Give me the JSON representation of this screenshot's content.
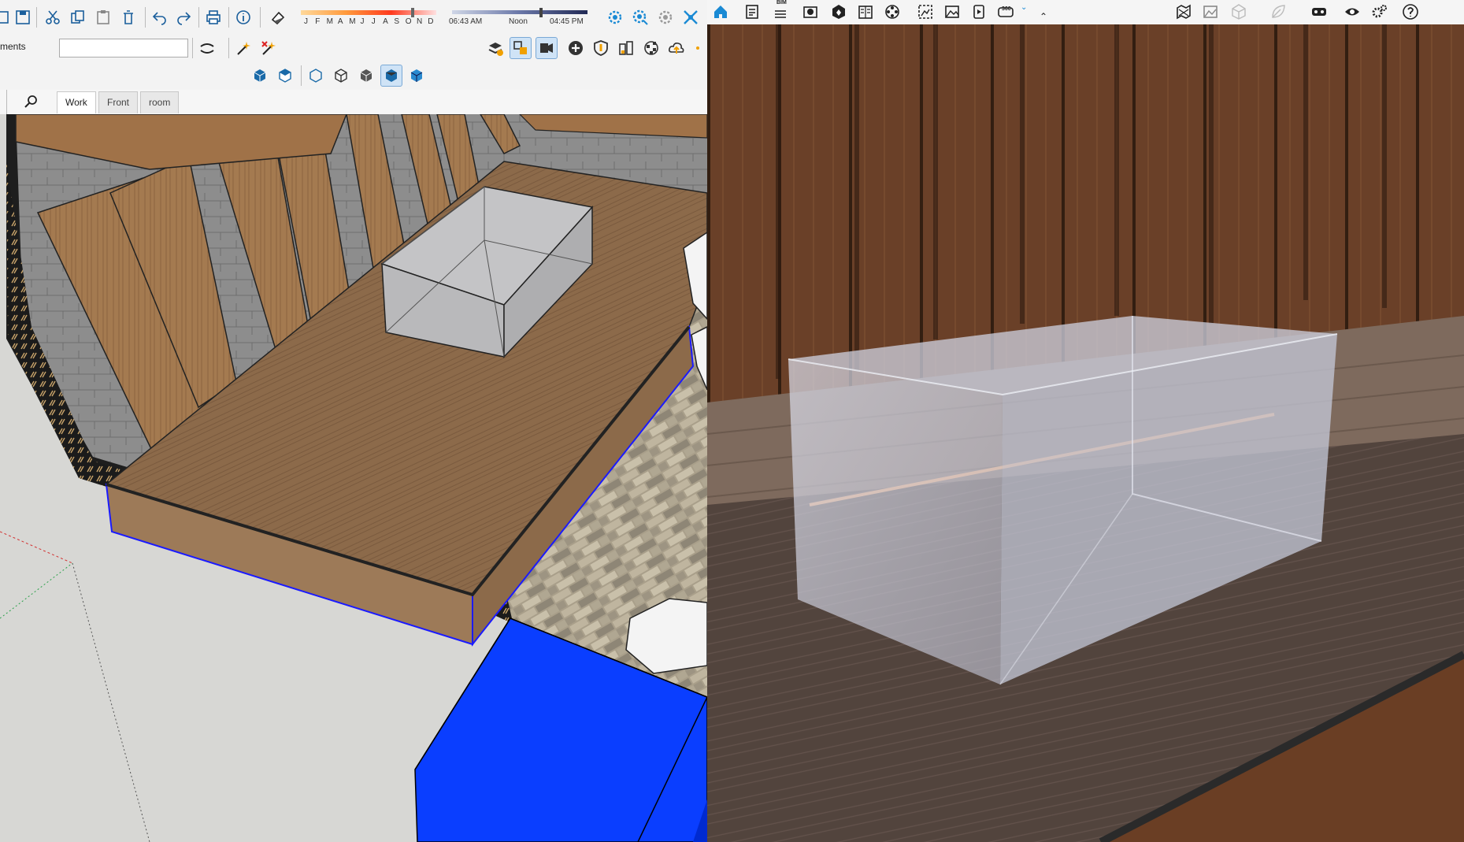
{
  "left_app": {
    "toolbar": {
      "months": [
        "J",
        "F",
        "M",
        "A",
        "M",
        "J",
        "J",
        "A",
        "S",
        "O",
        "N",
        "D"
      ],
      "time_start": "06:43 AM",
      "time_mid": "Noon",
      "time_end": "04:45 PM"
    },
    "shadow_label": "ments",
    "shadow_input_value": "",
    "scene_tabs": [
      {
        "label": "Work",
        "active": true
      },
      {
        "label": "Front",
        "active": false
      },
      {
        "label": "room",
        "active": false
      }
    ]
  },
  "right_app": {
    "toolbar_icons": [
      "home-icon",
      "document-icon",
      "bim-icon",
      "camera-icon",
      "cube-icon",
      "book-icon",
      "film-icon",
      "screenshot-icon",
      "image-icon",
      "video-icon",
      "vr-icon",
      "chevron-down-icon",
      "chevron-up-icon",
      "map-icon",
      "image-export-icon",
      "cube-outline-icon",
      "leaf-icon",
      "vr-headset-icon",
      "eye-icon",
      "settings-icon",
      "help-icon"
    ],
    "bim_label": "BIM",
    "vr_label": "360"
  },
  "colors": {
    "accent_blue": "#1a8ad4",
    "selected_blue": "#0044ff",
    "wood": "#8a5a36"
  }
}
